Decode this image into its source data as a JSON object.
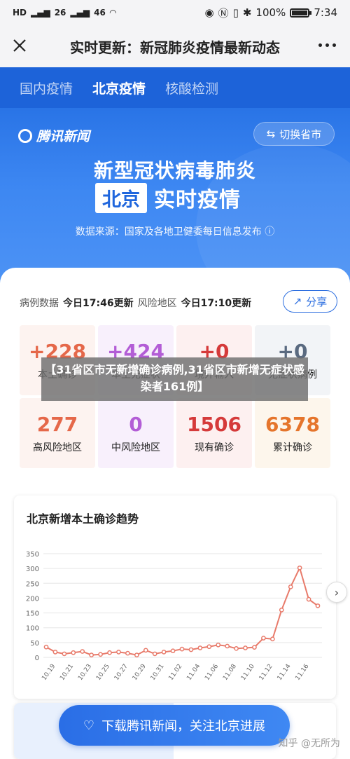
{
  "status_bar": {
    "left": [
      "HD",
      "26",
      "46"
    ],
    "battery": "100%",
    "time": "7:34"
  },
  "title_bar": {
    "title": "实时更新：新冠肺炎疫情最新动态"
  },
  "tabs": [
    {
      "label": "国内疫情",
      "active": false
    },
    {
      "label": "北京疫情",
      "active": true
    },
    {
      "label": "核酸检测",
      "active": false
    }
  ],
  "hero": {
    "logo": "腾讯新闻",
    "switch_label": "切换省市",
    "title_line1": "新型冠状病毒肺炎",
    "city": "北京",
    "title_line2": "实时疫情",
    "source": "数据来源：国家及各地卫健委每日信息发布"
  },
  "update": {
    "case_label": "病例数据",
    "case_time": "今日17:46更新",
    "risk_label": "风险地区",
    "risk_time": "今日17:10更新",
    "share_label": "分享"
  },
  "stats": [
    {
      "value": "+228",
      "label": "本土确诊",
      "color": "#e5684a",
      "bg": "#fdf3f0"
    },
    {
      "value": "+424",
      "label": "本土无症状",
      "color": "#b35dd6",
      "bg": "#f8f0fc"
    },
    {
      "value": "+0",
      "label": "境外输入",
      "color": "#d53a3a",
      "bg": "#fdf0f0"
    },
    {
      "value": "+0",
      "label": "无症状病例",
      "color": "#5a6a80",
      "bg": "#f2f4f7"
    },
    {
      "value": "277",
      "label": "高风险地区",
      "color": "#e5684a",
      "bg": "#fdf3f0"
    },
    {
      "value": "0",
      "label": "中风险地区",
      "color": "#b35dd6",
      "bg": "#f8f0fc"
    },
    {
      "value": "1506",
      "label": "现有确诊",
      "color": "#d53a3a",
      "bg": "#fdf0f0"
    },
    {
      "value": "6378",
      "label": "累计确诊",
      "color": "#e5752c",
      "bg": "#fdf6ec"
    }
  ],
  "overlay_text": "【31省区市无新增确诊病例,31省区市新增无症状感染者161例】",
  "chart_data": {
    "type": "line",
    "title": "北京新增本土确诊趋势",
    "xlabel": "",
    "ylabel": "",
    "ylim": [
      0,
      350
    ],
    "yticks": [
      0,
      50,
      100,
      150,
      200,
      250,
      300,
      350
    ],
    "x": [
      "10.18",
      "10.19",
      "10.20",
      "10.21",
      "10.22",
      "10.23",
      "10.24",
      "10.25",
      "10.26",
      "10.27",
      "10.28",
      "10.29",
      "10.30",
      "10.31",
      "11.01",
      "11.02",
      "11.03",
      "11.04",
      "11.05",
      "11.06",
      "11.07",
      "11.08",
      "11.09",
      "11.10",
      "11.11",
      "11.12",
      "11.13",
      "11.14",
      "11.15",
      "11.16"
    ],
    "xtick_labels": [
      "10.19",
      "10.21",
      "10.23",
      "10.25",
      "10.27",
      "10.29",
      "10.31",
      "11.02",
      "11.04",
      "11.06",
      "11.08",
      "11.10",
      "11.12",
      "11.14",
      "11.16"
    ],
    "series": [
      {
        "color": "#e87a6a",
        "values": [
          35,
          18,
          12,
          16,
          20,
          8,
          10,
          16,
          18,
          14,
          8,
          24,
          12,
          18,
          22,
          28,
          26,
          32,
          36,
          42,
          38,
          30,
          32,
          34,
          65,
          62,
          160,
          238,
          302,
          196,
          174
        ]
      }
    ]
  },
  "download_label": "下载腾讯新闻，关注北京进展",
  "watermark": "知乎 @无所为"
}
